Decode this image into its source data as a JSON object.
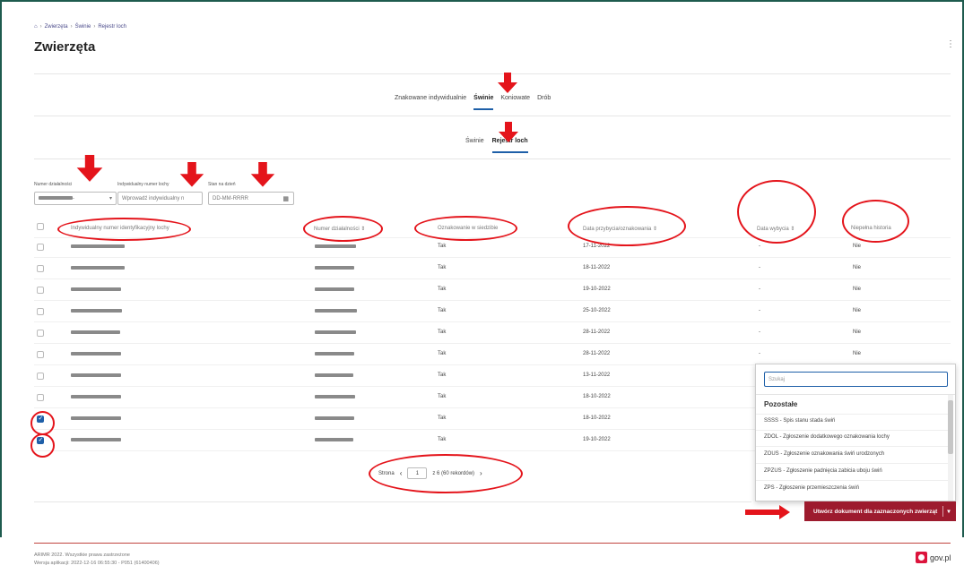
{
  "breadcrumb": {
    "home_icon": "home-icon",
    "items": [
      "Zwierzęta",
      "Świnie",
      "Rejestr loch"
    ]
  },
  "page": {
    "title": "Zwierzęta",
    "menu": "⋮"
  },
  "tabs": [
    "Znakowane indywidualnie",
    "Świnie",
    "Koniowate",
    "Drób"
  ],
  "subtabs": [
    "Świnie",
    "Rejestr loch"
  ],
  "filters": {
    "numer_label": "Numer działalności",
    "numer_value_suffix": "-",
    "indywidualny_label": "Indywidualny numer lochy",
    "indywidualny_placeholder": "Wprowadź indywidualny n",
    "stan_label": "Stan na dzień",
    "stan_placeholder": "DD-MM-RRRR"
  },
  "columns": {
    "c1": "Indywidualny numer identyfikacyjny lochy",
    "c2": "Numer działalności",
    "c3": "Oznakowanie w siedzibie",
    "c4": "Data przybycia/oznakowania",
    "c5": "Data wybycia",
    "c6": "Niepełna historia"
  },
  "rows": [
    {
      "oznakowanie": "Tak",
      "data": "17-11-2022",
      "wybycie": "-",
      "historia": "Nie",
      "checked": false
    },
    {
      "oznakowanie": "Tak",
      "data": "18-11-2022",
      "wybycie": "-",
      "historia": "Nie",
      "checked": false
    },
    {
      "oznakowanie": "Tak",
      "data": "19-10-2022",
      "wybycie": "-",
      "historia": "Nie",
      "checked": false
    },
    {
      "oznakowanie": "Tak",
      "data": "25-10-2022",
      "wybycie": "-",
      "historia": "Nie",
      "checked": false
    },
    {
      "oznakowanie": "Tak",
      "data": "28-11-2022",
      "wybycie": "-",
      "historia": "Nie",
      "checked": false
    },
    {
      "oznakowanie": "Tak",
      "data": "28-11-2022",
      "wybycie": "-",
      "historia": "Nie",
      "checked": false
    },
    {
      "oznakowanie": "Tak",
      "data": "13-11-2022",
      "wybycie": "-",
      "historia": "",
      "checked": false
    },
    {
      "oznakowanie": "Tak",
      "data": "18-10-2022",
      "wybycie": "-",
      "historia": "",
      "checked": false
    },
    {
      "oznakowanie": "Tak",
      "data": "18-10-2022",
      "wybycie": "-",
      "historia": "",
      "checked": true
    },
    {
      "oznakowanie": "Tak",
      "data": "19-10-2022",
      "wybycie": "-",
      "historia": "",
      "checked": true
    }
  ],
  "pager": {
    "label": "Strona",
    "page": "1",
    "of": "z 6 (60 rekordów)"
  },
  "dropdown": {
    "search_placeholder": "Szukaj",
    "group": "Pozostałe",
    "items": [
      "SSSS - Spis stanu stada świń",
      "ZDOL - Zgłoszenie dodatkowego oznakowania lochy",
      "ZOUS - Zgłoszenie oznakowania świń urodzonych",
      "ZPZUS - Zgłoszenie padnięcia zabicia uboju świń",
      "ZPS - Zgłoszenie przemieszczenia świń"
    ]
  },
  "create_button": {
    "label": "Utwórz dokument dla zaznaczonych zwierząt",
    "caret": "▾"
  },
  "footer": {
    "copyright": "ARIMR 2022. Wszystkie prawa zastrzeżone",
    "version": "Wersja aplikacji: 2022-12-16 06:55:30 - P051 (61400406)",
    "gov": "gov.pl"
  },
  "colors": {
    "accent": "#1e5fa8",
    "button": "#9d1b2e",
    "annotation": "#e4141b",
    "frame": "#1e5b4e"
  }
}
